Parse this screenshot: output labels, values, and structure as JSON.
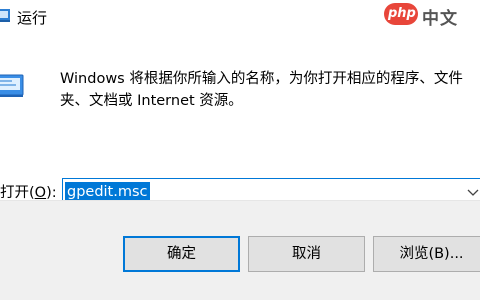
{
  "window": {
    "title": "运行",
    "app_icon": "run-app-icon"
  },
  "watermark": {
    "brand": "php",
    "text": "中文"
  },
  "content": {
    "icon": "run-program-icon",
    "description": "Windows 将根据你所输入的名称，为你打开相应的程序、文件夹、文档或 Internet 资源。"
  },
  "open_field": {
    "label_prefix": "打开(",
    "label_hotkey": "O",
    "label_suffix": "):",
    "value": "gpedit.msc",
    "dropdown_icon": "chevron-down-icon"
  },
  "buttons": {
    "ok": "确定",
    "cancel": "取消",
    "browse": "浏览(B)..."
  },
  "colors": {
    "accent": "#0078d7",
    "footer_bg": "#f0f0f0",
    "button_bg": "#e1e1e1",
    "watermark_red": "#e8463a"
  }
}
